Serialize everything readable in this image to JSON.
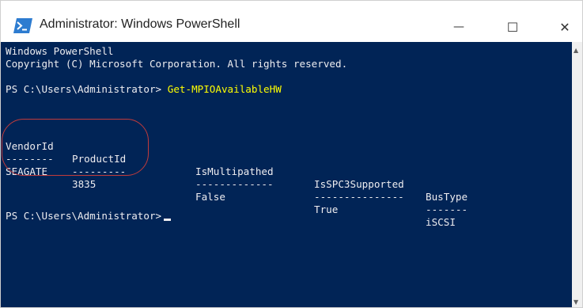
{
  "window": {
    "title": "Administrator: Windows PowerShell",
    "controls": {
      "minimize": "—",
      "maximize": "☐",
      "close": "✕"
    }
  },
  "console": {
    "header_line1": "Windows PowerShell",
    "header_line2": "Copyright (C) Microsoft Corporation. All rights reserved.",
    "prompt1": "PS C:\\Users\\Administrator>",
    "command1": "Get-MPIOAvailableHW",
    "table": {
      "headers": [
        "VendorId",
        "ProductId",
        "IsMultipathed",
        "IsSPC3Supported",
        "BusType"
      ],
      "separators": [
        "--------",
        "---------",
        "-------------",
        "---------------",
        "-------"
      ],
      "rows": [
        [
          "SEAGATE",
          "3835",
          "False",
          "True",
          "iSCSI"
        ]
      ]
    },
    "prompt2": "PS C:\\Users\\Administrator>"
  },
  "colors": {
    "console_bg": "#012456",
    "console_fg": "#eeedf0",
    "command": "#ffff00",
    "annotation_circle": "#c23b3b"
  },
  "icons": {
    "app": "powershell-icon",
    "scroll_up": "arrow-up-icon",
    "scroll_down": "arrow-down-icon"
  }
}
